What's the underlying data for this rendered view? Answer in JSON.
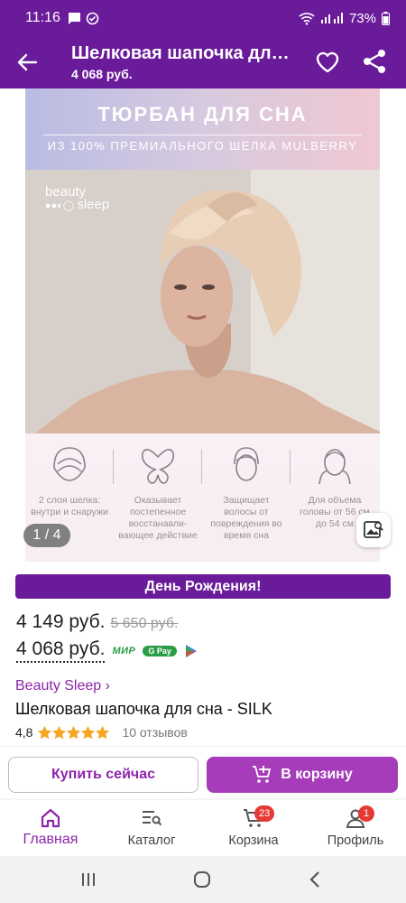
{
  "status": {
    "time": "11:16",
    "battery": "73%"
  },
  "header": {
    "title": "Шелковая шапочка для сна - SILK",
    "price": "4 068 руб."
  },
  "gallery": {
    "banner_title": "ТЮРБАН ДЛЯ СНА",
    "banner_subtitle": "ИЗ 100% ПРЕМИАЛЬНОГО ШЕЛКА MULBERRY",
    "logo_line1": "beauty",
    "logo_line2": "sleep",
    "counter": "1 / 4",
    "features": [
      "2 слоя шелка: внутри и снаружи",
      "Оказывает постепенное восстанавли-вающее действие",
      "Защищает волосы от повреждения во время сна",
      "Для объема головы от 56 см до 54 см"
    ]
  },
  "promo": {
    "label": "День Рождения!"
  },
  "prices": {
    "regular": "4 149 руб.",
    "old": "5 650 руб.",
    "card": "4 068 руб.",
    "pay_mir": "МИР",
    "pay_gpay": "G Pay"
  },
  "product": {
    "brand": "Beauty Sleep ›",
    "title": "Шелковая шапочка для сна - SILK",
    "rating": "4,8",
    "rating_value": 4.8,
    "reviews": "10 отзывов"
  },
  "actions": {
    "buy_now": "Купить сейчас",
    "add_to_cart": "В корзину"
  },
  "bottom_nav": {
    "home": "Главная",
    "catalog": "Каталог",
    "cart": "Корзина",
    "cart_badge": "23",
    "profile": "Профиль",
    "profile_badge": "1"
  },
  "colors": {
    "primary": "#6a1b9a",
    "accent": "#8e24aa",
    "button": "#a63cb9",
    "star": "#f5a623",
    "badge": "#e53935"
  }
}
